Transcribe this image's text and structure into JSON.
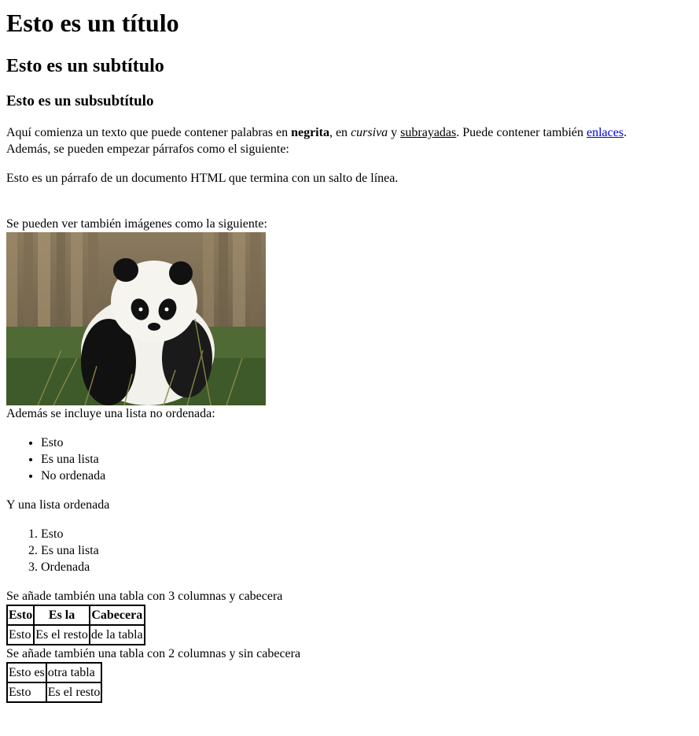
{
  "title": "Esto es un título",
  "subtitle": "Esto es un subtítulo",
  "subsubtitle": "Esto es un subsubtítulo",
  "para1": {
    "t1": "Aquí comienza un texto que puede contener palabras en ",
    "bold": "negrita",
    "t2": ", en ",
    "italic": "cursiva",
    "t3": " y ",
    "underline": "subrayadas",
    "t4": ". Puede contener también ",
    "link": "enlaces",
    "t5": ".",
    "line2": "Además, se pueden empezar párrafos como el siguiente:"
  },
  "para2": "Esto es un párrafo de un documento HTML que termina con un salto de línea.",
  "image_intro": "Se pueden ver también imágenes como la siguiente:",
  "list_intro": "Además se incluye una lista no ordenada:",
  "unordered_list": [
    "Esto",
    "Es una lista",
    "No ordenada"
  ],
  "ordered_intro": "Y una lista ordenada",
  "ordered_list": [
    "Esto",
    "Es una lista",
    "Ordenada"
  ],
  "table1_intro": "Se añade también una tabla con 3 columnas y cabecera",
  "table1": {
    "headers": [
      "Esto",
      "Es la",
      "Cabecera"
    ],
    "row": [
      "Esto",
      "Es el resto",
      "de la tabla"
    ]
  },
  "table2_intro": "Se añade también una tabla con 2 columnas y sin cabecera",
  "table2": {
    "rows": [
      [
        "Esto es",
        "otra tabla"
      ],
      [
        "Esto",
        "Es el resto"
      ]
    ]
  }
}
